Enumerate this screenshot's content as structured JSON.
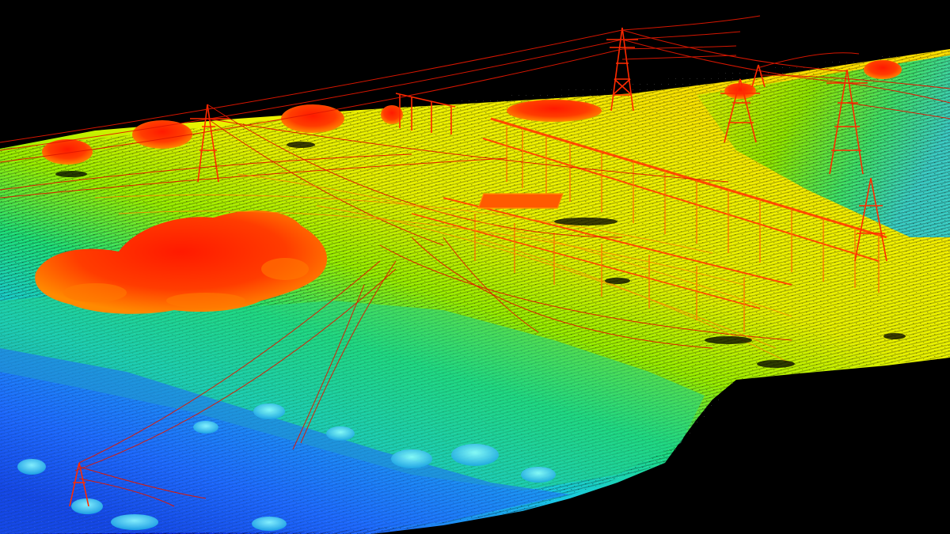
{
  "scene": {
    "subject": "point-cloud",
    "background_color": "#000000",
    "elevation_palette": [
      "#0a1ecc",
      "#1f6bff",
      "#19c8e6",
      "#1ee07a",
      "#9af000",
      "#f2f200",
      "#ffb000",
      "#ff6a00",
      "#ff2a00",
      "#e00000"
    ]
  }
}
